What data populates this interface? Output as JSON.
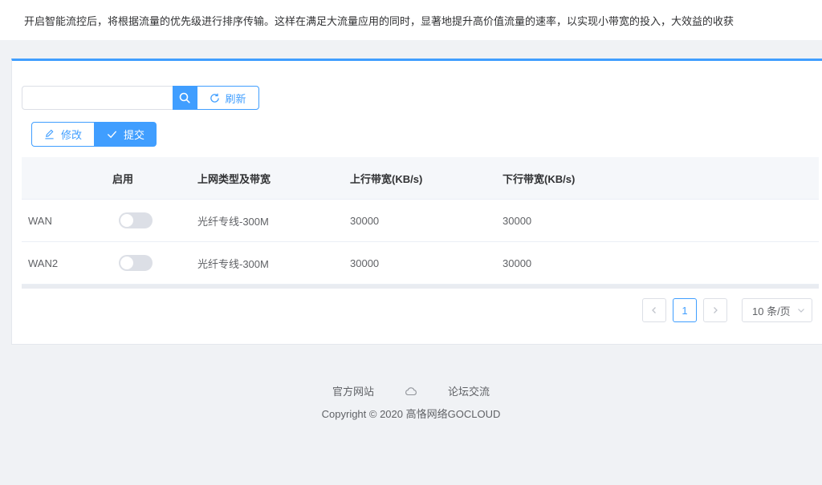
{
  "notice": "开启智能流控后，将根据流量的优先级进行排序传输。这样在满足大流量应用的同时，显著地提升高价值流量的速率，以实现小带宽的投入，大效益的收获",
  "toolbar": {
    "search_value": "",
    "refresh_label": "刷新",
    "edit_label": "修改",
    "submit_label": "提交"
  },
  "table": {
    "headers": [
      "",
      "启用",
      "上网类型及带宽",
      "上行带宽(KB/s)",
      "下行带宽(KB/s)"
    ],
    "rows": [
      {
        "name": "WAN",
        "enabled": false,
        "type": "光纤专线-300M",
        "up": "30000",
        "down": "30000"
      },
      {
        "name": "WAN2",
        "enabled": false,
        "type": "光纤专线-300M",
        "up": "30000",
        "down": "30000"
      }
    ]
  },
  "pagination": {
    "current_page": "1",
    "page_size": "10 条/页"
  },
  "footer": {
    "link_official": "官方网站",
    "link_forum": "论坛交流",
    "copyright": "Copyright © 2020 高恪网络GOCLOUD"
  },
  "colors": {
    "accent": "#409eff",
    "background": "#f0f2f5"
  }
}
